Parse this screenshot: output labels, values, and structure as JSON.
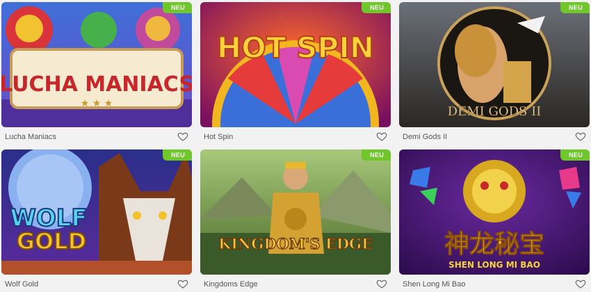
{
  "games": [
    {
      "title": "Lucha Maniacs",
      "badge": "NEU",
      "art_text": "LUCHA MANIACS",
      "favorite_icon": "heart-outline-icon"
    },
    {
      "title": "Hot Spin",
      "badge": "NEU",
      "art_text": "HOT SPIN",
      "favorite_icon": "heart-outline-icon"
    },
    {
      "title": "Demi Gods II",
      "badge": "NEU",
      "art_text": "DEMI GODS II",
      "favorite_icon": "heart-outline-icon"
    },
    {
      "title": "Wolf Gold",
      "badge": "NEU",
      "art_text_line1": "WOLF",
      "art_text_line2": "GOLD",
      "favorite_icon": "heart-outline-icon"
    },
    {
      "title": "Kingdoms Edge",
      "badge": "NEU",
      "art_text": "KINGDOM'S EDGE",
      "favorite_icon": "heart-outline-icon"
    },
    {
      "title": "Shen Long Mi Bao",
      "badge": "NEU",
      "art_text_cn": "神龙秘宝",
      "art_text": "SHEN LONG MI BAO",
      "favorite_icon": "heart-outline-icon"
    }
  ],
  "colors": {
    "badge": "#6fc72b",
    "caption": "#555555",
    "background": "#f2f2f2"
  }
}
